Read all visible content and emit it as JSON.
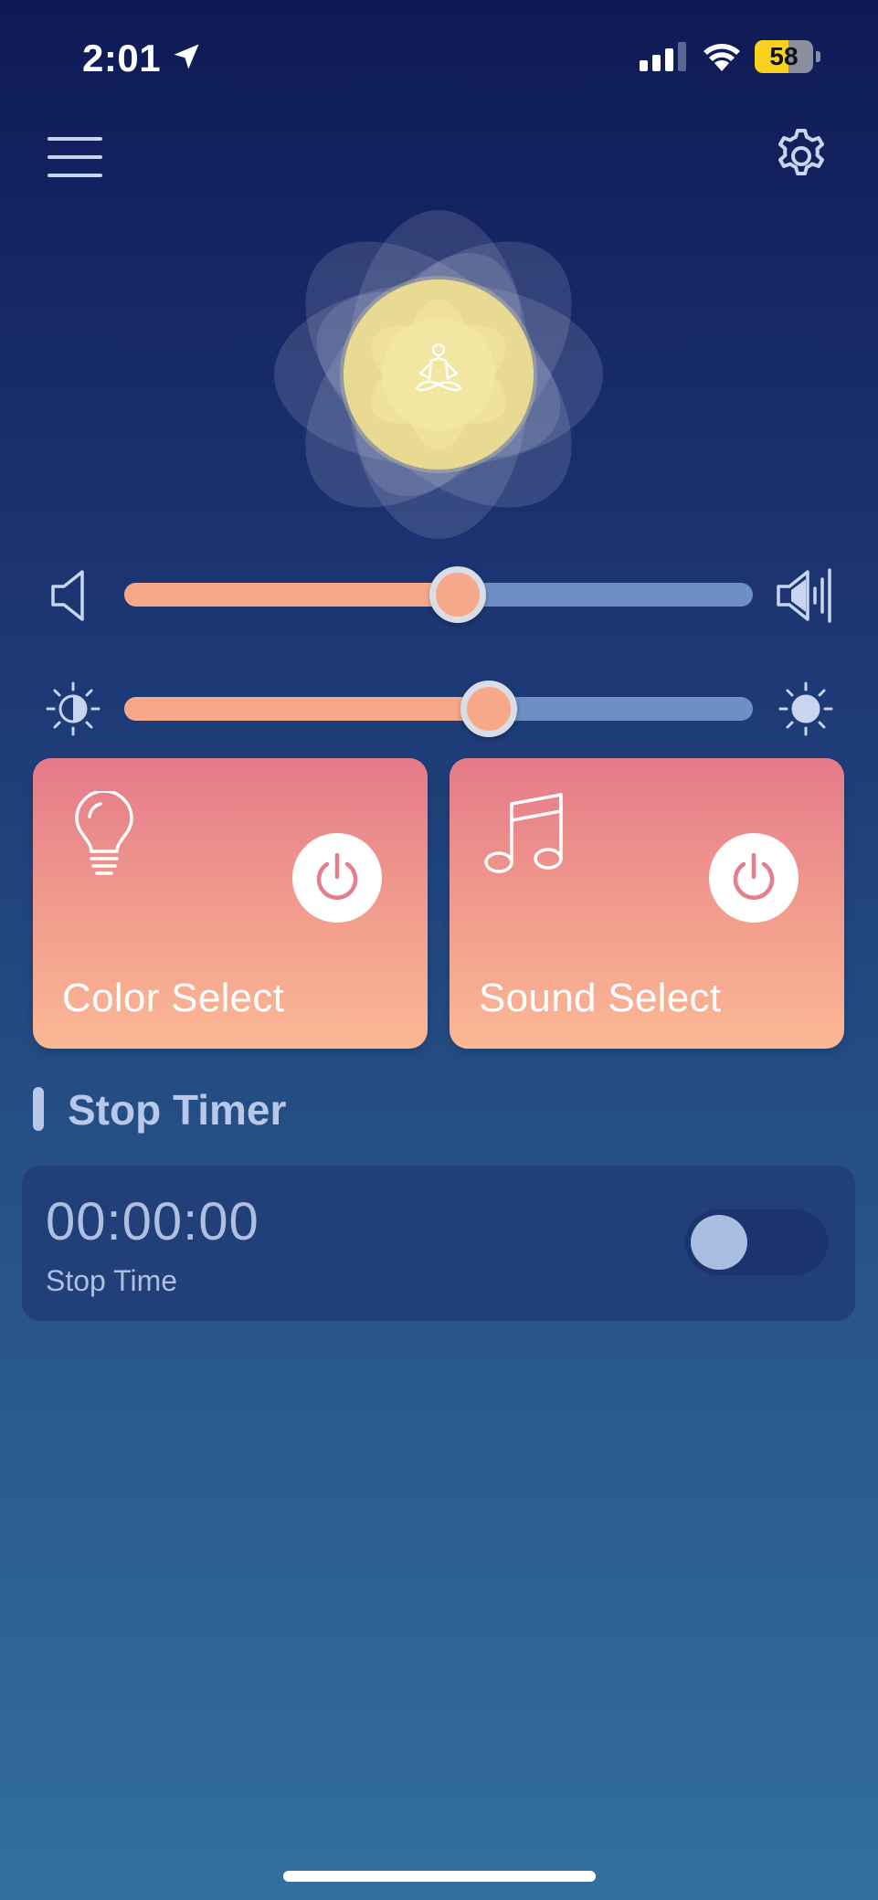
{
  "status_bar": {
    "time": "2:01",
    "battery_level": 58,
    "battery_text": "58"
  },
  "header": {
    "menu_icon": "hamburger-menu-icon",
    "settings_icon": "gear-icon"
  },
  "center": {
    "icon": "meditation-icon",
    "glow_color": "#f2e69a"
  },
  "sliders": {
    "volume": {
      "value": 0.53,
      "min_icon": "speaker-low-icon",
      "max_icon": "speaker-high-icon"
    },
    "brightness": {
      "value": 0.58,
      "min_icon": "brightness-low-icon",
      "max_icon": "brightness-high-icon"
    }
  },
  "cards": [
    {
      "label": "Color Select",
      "icon": "lightbulb-icon",
      "power_icon": "power-icon"
    },
    {
      "label": "Sound Select",
      "icon": "music-note-icon",
      "power_icon": "power-icon"
    }
  ],
  "stop_timer": {
    "title": "Stop Timer",
    "value": "00:00:00",
    "label": "Stop Time",
    "enabled": false
  },
  "colors": {
    "accent": "#f6a98a",
    "track": "#6d8fc3",
    "card_top": "#e57a89",
    "card_bottom": "#fbb894"
  }
}
